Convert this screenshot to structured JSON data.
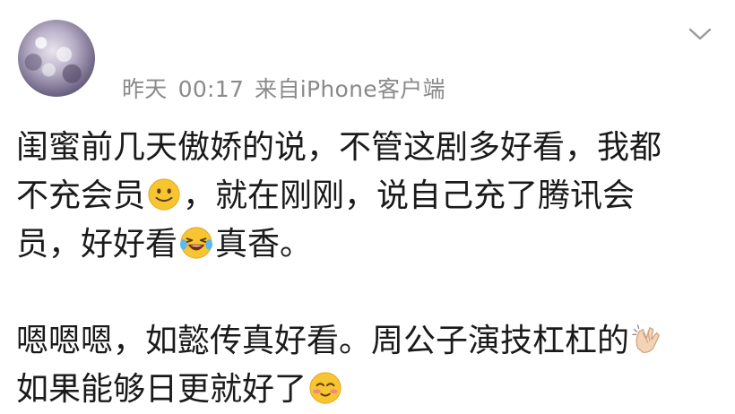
{
  "post": {
    "meta": {
      "date": "昨天",
      "time": "00:17",
      "source": "来自iPhone客户端"
    },
    "paragraphs": [
      {
        "lines": [
          [
            "闺蜜前几天傲娇的说，不管这剧多好看，我都"
          ],
          [
            "不充会员",
            "",
            "，就在刚刚，说自己充了腾讯会"
          ],
          [
            "员，好好看",
            "",
            "真香。"
          ]
        ]
      },
      {
        "lines": [
          [
            "嗯嗯嗯，如懿传真好看。周公子演技杠杠的",
            ""
          ],
          [
            "如果能够日更就好了",
            ""
          ]
        ]
      }
    ],
    "icons": {
      "more": "chevron-down-icon",
      "smile": "smiling-emoji-icon",
      "laugh": "laughing-tears-emoji-icon",
      "clap": "clapping-hands-emoji-icon",
      "blush": "blushing-emoji-icon"
    },
    "colors": {
      "text": "#1a1a1a",
      "meta": "#8a8a8a",
      "emoji_yellow": "#f7c531"
    }
  }
}
